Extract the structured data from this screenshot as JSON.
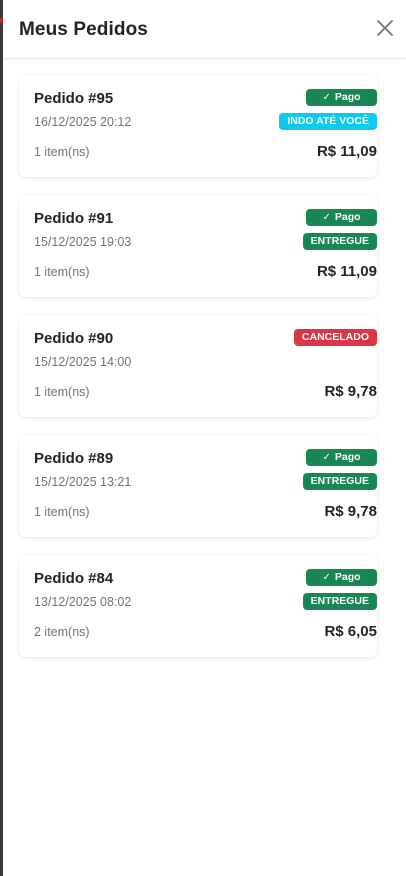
{
  "header": {
    "title": "Meus Pedidos",
    "close_icon": "close-icon"
  },
  "colors": {
    "paid": "#198754",
    "delivered": "#198754",
    "in_transit": "#0dcaf0",
    "cancelled": "#dc3545",
    "text": "#212529",
    "muted": "#6c757d"
  },
  "orders": [
    {
      "number": "Pedido #95",
      "date": "16/12/2025 20:12",
      "items": "1 item(ns)",
      "total": "R$ 11,09",
      "payment": "Pago",
      "status": "INDO ATÉ VOCÊ"
    },
    {
      "number": "Pedido #91",
      "date": "15/12/2025 19:03",
      "items": "1 item(ns)",
      "total": "R$ 11,09",
      "payment": "Pago",
      "status": "ENTREGUE"
    },
    {
      "number": "Pedido #90",
      "date": "15/12/2025 14:00",
      "items": "1 item(ns)",
      "total": "R$ 9,78",
      "status": "CANCELADO"
    },
    {
      "number": "Pedido #89",
      "date": "15/12/2025 13:21",
      "items": "1 item(ns)",
      "total": "R$ 9,78",
      "payment": "Pago",
      "status": "ENTREGUE"
    },
    {
      "number": "Pedido #84",
      "date": "13/12/2025 08:02",
      "items": "2 item(ns)",
      "total": "R$ 6,05",
      "payment": "Pago",
      "status": "ENTREGUE"
    }
  ]
}
